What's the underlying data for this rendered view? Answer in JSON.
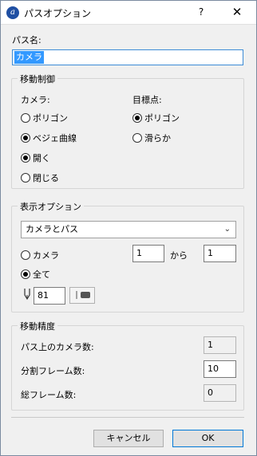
{
  "window": {
    "title": "パスオプション",
    "help_label": "?",
    "close_label": "✕",
    "app_icon_glyph": "a"
  },
  "path_name": {
    "label": "パス名:",
    "value": "カメラ"
  },
  "movement_control": {
    "title": "移動制御",
    "camera_label": "カメラ:",
    "target_label": "目標点:",
    "camera_options": [
      {
        "label": "ポリゴン",
        "selected": false
      },
      {
        "label": "ベジェ曲線",
        "selected": true
      },
      {
        "label": "開く",
        "selected": true
      },
      {
        "label": "閉じる",
        "selected": false
      }
    ],
    "target_options": [
      {
        "label": "ポリゴン",
        "selected": true
      },
      {
        "label": "滑らか",
        "selected": false
      }
    ]
  },
  "display_options": {
    "title": "表示オプション",
    "combo_value": "カメラとパス",
    "camera_radio_label": "カメラ",
    "from_value": "1",
    "from_label": "から",
    "to_value": "1",
    "all_label": "全て",
    "pen_value": "81"
  },
  "movement_precision": {
    "title": "移動精度",
    "cameras_on_path_label": "パス上のカメラ数:",
    "cameras_on_path_value": "1",
    "split_frames_label": "分割フレーム数:",
    "split_frames_value": "10",
    "total_frames_label": "総フレーム数:",
    "total_frames_value": "0"
  },
  "buttons": {
    "cancel": "キャンセル",
    "ok": "OK"
  },
  "colors": {
    "selection": "#3399ff",
    "focus_border": "#0078d7",
    "app_icon": "#1f4fa3"
  }
}
